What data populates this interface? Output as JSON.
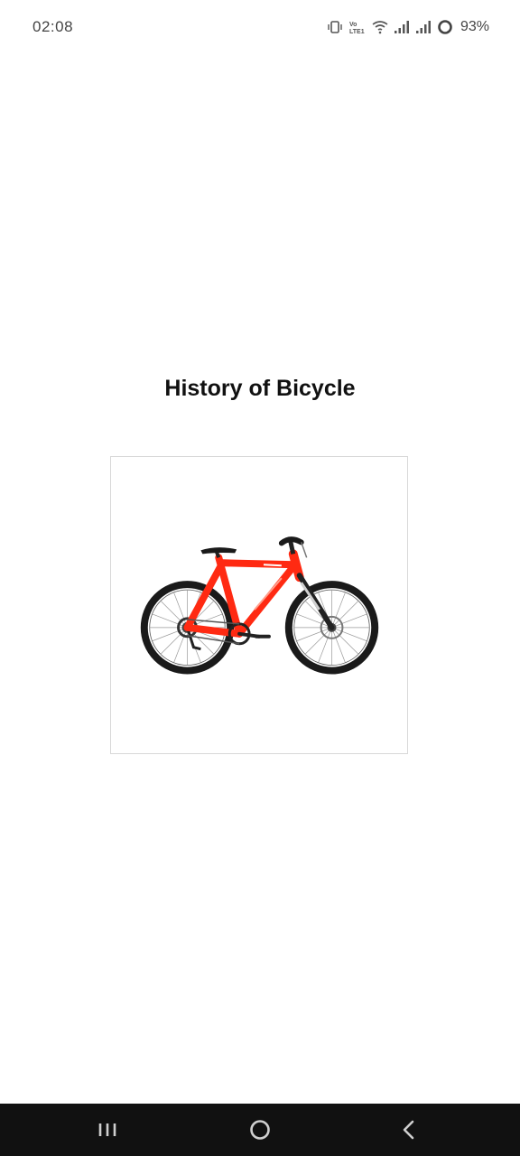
{
  "status_bar": {
    "time": "02:08",
    "battery_percent": "93%",
    "network_label": "VoLTE1"
  },
  "main": {
    "title": "History of Bicycle",
    "image": {
      "subject": "red mountain bicycle",
      "colors": {
        "frame": "#ff2a12",
        "tire": "#1a1a1a",
        "border": "#d8d8d8"
      }
    }
  },
  "nav_bar": {
    "buttons": [
      "recent-apps",
      "home",
      "back"
    ],
    "background": "#111111"
  }
}
